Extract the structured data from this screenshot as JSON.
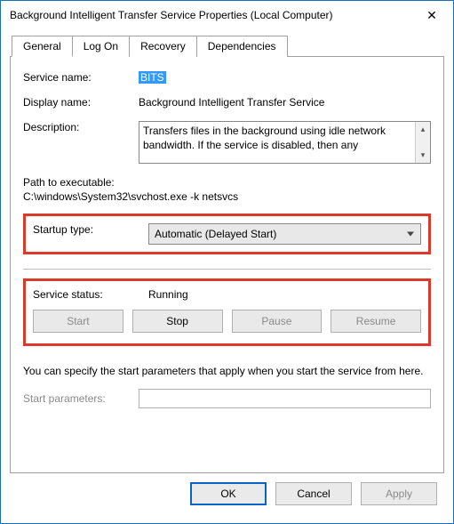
{
  "window": {
    "title": "Background Intelligent Transfer Service Properties (Local Computer)"
  },
  "tabs": {
    "general": "General",
    "logon": "Log On",
    "recovery": "Recovery",
    "dependencies": "Dependencies"
  },
  "labels": {
    "service_name": "Service name:",
    "display_name": "Display name:",
    "description": "Description:",
    "path_to_exe": "Path to executable:",
    "startup_type": "Startup type:",
    "service_status": "Service status:",
    "start_parameters": "Start parameters:"
  },
  "values": {
    "service_name": "BITS",
    "display_name": "Background Intelligent Transfer Service",
    "description": "Transfers files in the background using idle network bandwidth. If the service is disabled, then any",
    "path": "C:\\windows\\System32\\svchost.exe -k netsvcs",
    "startup_type": "Automatic (Delayed Start)",
    "service_status": "Running",
    "start_parameters": ""
  },
  "buttons": {
    "start": "Start",
    "stop": "Stop",
    "pause": "Pause",
    "resume": "Resume",
    "ok": "OK",
    "cancel": "Cancel",
    "apply": "Apply"
  },
  "hint": "You can specify the start parameters that apply when you start the service from here."
}
